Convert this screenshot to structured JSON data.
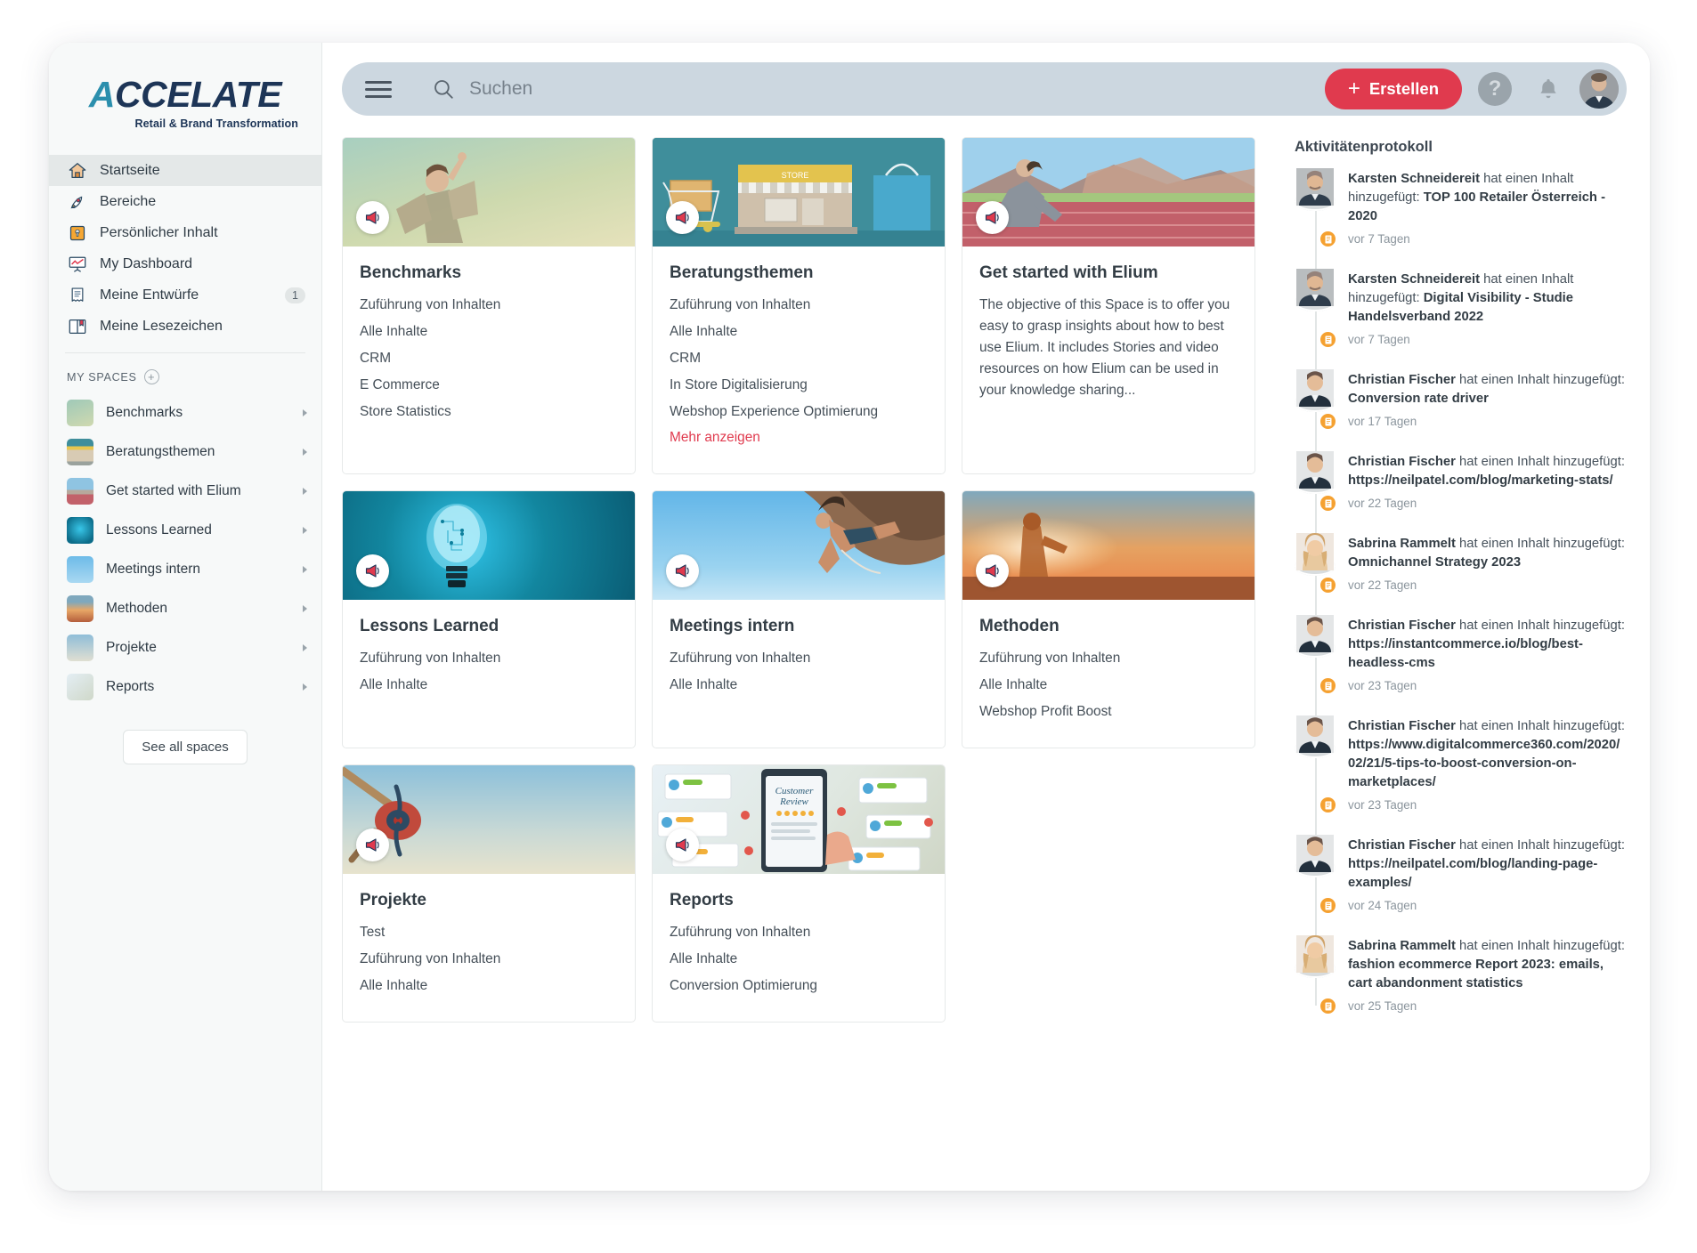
{
  "brand": {
    "logo_lead": "A",
    "logo_rest": "CCELATE",
    "tagline": "Retail & Brand Transformation",
    "accent_color": "#e03a4e",
    "logo_teal": "#2b8fad",
    "logo_navy": "#1d3557"
  },
  "search": {
    "placeholder": "Suchen",
    "value": ""
  },
  "header": {
    "create_label": "Erstellen",
    "create_plus": "+",
    "help_glyph": "?"
  },
  "sidebar": {
    "nav": [
      {
        "label": "Startseite",
        "icon": "home-icon",
        "active": true,
        "badge": ""
      },
      {
        "label": "Bereiche",
        "icon": "rocket-icon",
        "active": false,
        "badge": ""
      },
      {
        "label": "Persönlicher Inhalt",
        "icon": "lock-icon",
        "active": false,
        "badge": ""
      },
      {
        "label": "My Dashboard",
        "icon": "presentation-chart-icon",
        "active": false,
        "badge": ""
      },
      {
        "label": "Meine Entwürfe",
        "icon": "draft-document-icon",
        "active": false,
        "badge": "1"
      },
      {
        "label": "Meine Lesezeichen",
        "icon": "bookmark-book-icon",
        "active": false,
        "badge": ""
      }
    ],
    "spaces_header": "MY SPACES",
    "add_space_glyph": "+",
    "spaces": [
      {
        "label": "Benchmarks",
        "thumb": "benchmarks"
      },
      {
        "label": "Beratungsthemen",
        "thumb": "beratung"
      },
      {
        "label": "Get started with Elium",
        "thumb": "elium"
      },
      {
        "label": "Lessons Learned",
        "thumb": "lessons"
      },
      {
        "label": "Meetings intern",
        "thumb": "meetings"
      },
      {
        "label": "Methoden",
        "thumb": "methoden"
      },
      {
        "label": "Projekte",
        "thumb": "projekte"
      },
      {
        "label": "Reports",
        "thumb": "reports"
      }
    ],
    "see_all_label": "See all spaces"
  },
  "cards": [
    {
      "title": "Benchmarks",
      "hero": "benchmarks",
      "lines": [
        "Zuführung von Inhalten",
        "Alle Inhalte",
        "CRM",
        "E Commerce",
        "Store Statistics"
      ],
      "more": "",
      "desc": ""
    },
    {
      "title": "Beratungsthemen",
      "hero": "beratung",
      "lines": [
        "Zuführung von Inhalten",
        "Alle Inhalte",
        "CRM",
        "In Store Digitalisierung",
        "Webshop Experience Optimierung"
      ],
      "more": "Mehr anzeigen",
      "desc": ""
    },
    {
      "title": "Get started with Elium",
      "hero": "elium",
      "lines": [],
      "more": "",
      "desc": "The objective of this Space is to offer you easy to grasp insights about how to best use Elium. It includes Stories and video resources on how Elium can be used in your knowledge sharing..."
    },
    {
      "title": "Lessons Learned",
      "hero": "lessons",
      "lines": [
        "Zuführung von Inhalten",
        "Alle Inhalte"
      ],
      "more": "",
      "desc": ""
    },
    {
      "title": "Meetings intern",
      "hero": "meetings",
      "lines": [
        "Zuführung von Inhalten",
        "Alle Inhalte"
      ],
      "more": "",
      "desc": ""
    },
    {
      "title": "Methoden",
      "hero": "methoden",
      "lines": [
        "Zuführung von Inhalten",
        "Alle Inhalte",
        "Webshop Profit Boost"
      ],
      "more": "",
      "desc": ""
    },
    {
      "title": "Projekte",
      "hero": "projekte",
      "lines": [
        "Test",
        "Zuführung von Inhalten",
        "Alle Inhalte"
      ],
      "more": "",
      "desc": ""
    },
    {
      "title": "Reports",
      "hero": "reports",
      "lines": [
        "Zuführung von Inhalten",
        "Alle Inhalte",
        "Conversion Optimierung"
      ],
      "more": "",
      "desc": ""
    }
  ],
  "activity": {
    "title": "Aktivitätenprotokoll",
    "action_text": "hat einen Inhalt hinzugefügt:",
    "items": [
      {
        "user": "Karsten Schneidereit",
        "avatar": "karsten",
        "action": "hat einen Inhalt hinzugefügt:",
        "subject": "TOP 100 Retailer Österreich - 2020",
        "time": "vor 7 Tagen"
      },
      {
        "user": "Karsten Schneidereit",
        "avatar": "karsten",
        "action": "hat einen Inhalt hinzugefügt:",
        "subject": "Digital Visibility - Studie Handelsverband 2022",
        "time": "vor 7 Tagen"
      },
      {
        "user": "Christian Fischer",
        "avatar": "christian",
        "action": "hat einen Inhalt hinzugefügt:",
        "subject": "Conversion rate driver",
        "time": "vor 17 Tagen"
      },
      {
        "user": "Christian Fischer",
        "avatar": "christian",
        "action": "hat einen Inhalt hinzugefügt:",
        "subject": "https://neilpatel.com/blog/marketing-stats/",
        "time": "vor 22 Tagen"
      },
      {
        "user": "Sabrina Rammelt",
        "avatar": "sabrina",
        "action": "hat einen Inhalt hinzugefügt:",
        "subject": "Omnichannel Strategy 2023",
        "time": "vor 22 Tagen"
      },
      {
        "user": "Christian Fischer",
        "avatar": "christian",
        "action": "hat einen Inhalt hinzugefügt:",
        "subject": "https://instantcommerce.io/blog/best-headless-cms",
        "time": "vor 23 Tagen"
      },
      {
        "user": "Christian Fischer",
        "avatar": "christian",
        "action": "hat einen Inhalt hinzugefügt:",
        "subject": "https://www.digitalcommerce360.com/2020/02/21/5-tips-to-boost-conversion-on-marketplaces/",
        "time": "vor 23 Tagen"
      },
      {
        "user": "Christian Fischer",
        "avatar": "christian",
        "action": "hat einen Inhalt hinzugefügt:",
        "subject": "https://neilpatel.com/blog/landing-page-examples/",
        "time": "vor 24 Tagen"
      },
      {
        "user": "Sabrina Rammelt",
        "avatar": "sabrina",
        "action": "hat einen Inhalt hinzugefügt:",
        "subject": "fashion ecommerce Report 2023: emails, cart abandonment statistics",
        "time": "vor 25 Tagen"
      }
    ]
  }
}
